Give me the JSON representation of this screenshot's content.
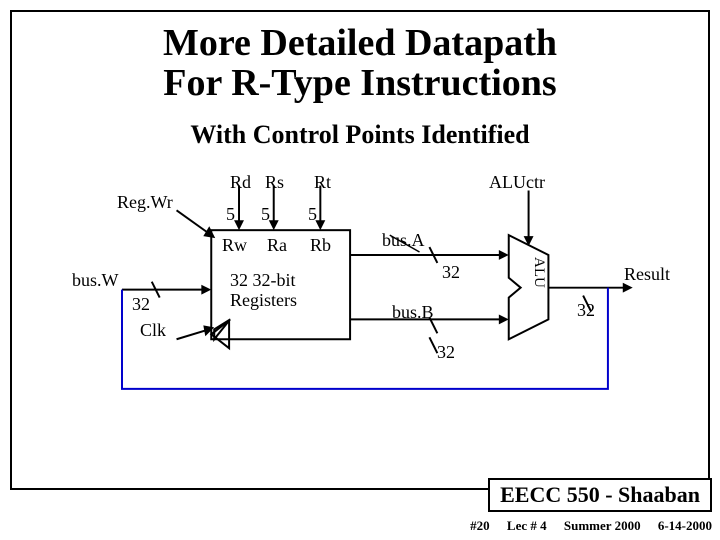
{
  "title_line1": "More Detailed Datapath",
  "title_line2": "For R-Type Instructions",
  "subtitle": "With Control Points Identified",
  "labels": {
    "rd": "Rd",
    "rs": "Rs",
    "rt": "Rt",
    "regwr": "Reg.Wr",
    "five_a": "5",
    "five_b": "5",
    "five_c": "5",
    "rw": "Rw",
    "ra": "Ra",
    "rb": "Rb",
    "regfile_line1": "32 32-bit",
    "regfile_line2": "Registers",
    "busw": "bus.W",
    "busw_width": "32",
    "clk": "Clk",
    "busa": "bus.A",
    "busa_width": "32",
    "busb": "bus.B",
    "busb_width": "32",
    "aluctr": "ALUctr",
    "alu": "ALU",
    "result": "Result",
    "result_width": "32"
  },
  "footer": {
    "course": "EECC 550 - Shaaban",
    "slide": "#20",
    "lecture": "Lec # 4",
    "term": "Summer 2000",
    "date": "6-14-2000"
  }
}
